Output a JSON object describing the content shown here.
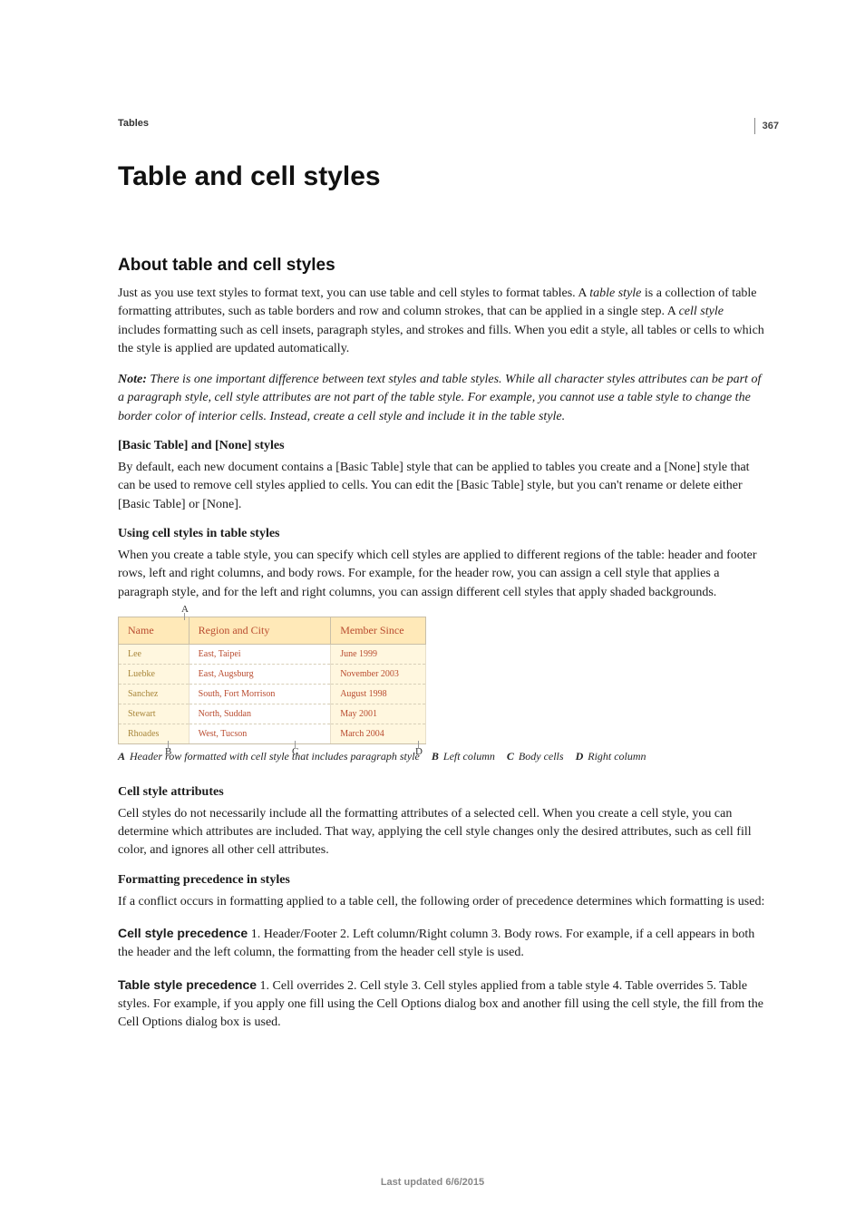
{
  "page_number": "367",
  "breadcrumb": "Tables",
  "title": "Table and cell styles",
  "section_heading": "About table and cell styles",
  "intro": {
    "pre": "Just as you use text styles to format text, you can use table and cell styles to format tables. A ",
    "term1": "table style",
    "mid1": " is a collection of table formatting attributes, such as table borders and row and column strokes, that can be applied in a single step. A ",
    "term2": "cell style",
    "post": " includes formatting such as cell insets, paragraph styles, and strokes and fills. When you edit a style, all tables or cells to which the style is applied are updated automatically."
  },
  "note": {
    "label": "Note:",
    "text": " There is one important difference between text styles and table styles. While all character styles attributes can be part of a paragraph style, cell style attributes are not part of the table style. For example, you cannot use a table style to change the border color of interior cells. Instead, create a cell style and include it in the table style."
  },
  "sub1": {
    "heading": "[Basic Table] and [None] styles",
    "body": "By default, each new document contains a [Basic Table] style that can be applied to tables you create and a [None] style that can be used to remove cell styles applied to cells. You can edit the [Basic Table] style, but you can't rename or delete either [Basic Table] or [None]."
  },
  "sub2": {
    "heading": "Using cell styles in table styles",
    "body": "When you create a table style, you can specify which cell styles are applied to different regions of the table: header and footer rows, left and right columns, and body rows. For example, for the header row, you can assign a cell style that applies a paragraph style, and for the left and right columns, you can assign different cell styles that apply shaded backgrounds."
  },
  "figure": {
    "marks": {
      "a": "A",
      "b": "B",
      "c": "C",
      "d": "D"
    },
    "headers": [
      "Name",
      "Region and City",
      "Member Since"
    ],
    "rows": [
      {
        "name": "Lee",
        "region": "East, Taipei",
        "member": "June 1999"
      },
      {
        "name": "Luebke",
        "region": "East, Augsburg",
        "member": "November 2003"
      },
      {
        "name": "Sanchez",
        "region": "South, Fort Morrison",
        "member": "August 1998"
      },
      {
        "name": "Stewart",
        "region": "North, Suddan",
        "member": "May 2001"
      },
      {
        "name": "Rhoades",
        "region": "West, Tucson",
        "member": "March 2004"
      }
    ]
  },
  "caption": {
    "a_label": "A",
    "a_text": "Header row formatted with cell style that includes paragraph style",
    "b_label": "B",
    "b_text": "Left column",
    "c_label": "C",
    "c_text": "Body cells",
    "d_label": "D",
    "d_text": "Right column"
  },
  "sub3": {
    "heading": "Cell style attributes",
    "body": "Cell styles do not necessarily include all the formatting attributes of a selected cell. When you create a cell style, you can determine which attributes are included. That way, applying the cell style changes only the desired attributes, such as cell fill color, and ignores all other cell attributes."
  },
  "sub4": {
    "heading": "Formatting precedence in styles",
    "body": "If a conflict occurs in formatting applied to a table cell, the following order of precedence determines which formatting is used:"
  },
  "prec1": {
    "label": "Cell style precedence",
    "text": " 1. Header/Footer 2. Left column/Right column 3. Body rows. For example, if a cell appears in both the header and the left column, the formatting from the header cell style is used."
  },
  "prec2": {
    "label": "Table style precedence",
    "text": " 1. Cell overrides 2. Cell style 3. Cell styles applied from a table style 4. Table overrides 5. Table styles. For example, if you apply one fill using the Cell Options dialog box and another fill using the cell style, the fill from the Cell Options dialog box is used."
  },
  "footer": "Last updated 6/6/2015"
}
